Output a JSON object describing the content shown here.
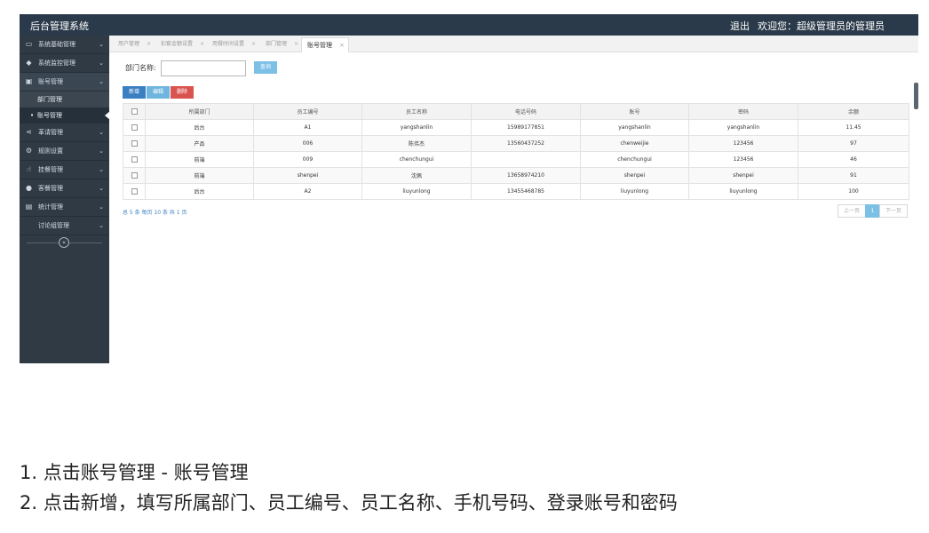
{
  "app": {
    "title": "后台管理系统",
    "logout": "退出",
    "welcome": "欢迎您：超级管理员的管理员"
  },
  "sidebar": {
    "items": [
      {
        "label": "系统基础管理",
        "icon": "monitor-icon"
      },
      {
        "label": "系统监控管理",
        "icon": "tag-icon"
      },
      {
        "label": "账号管理",
        "icon": "image-icon"
      },
      {
        "label": "革请管理",
        "icon": "share-icon"
      },
      {
        "label": "规则设置",
        "icon": "gear-icon"
      },
      {
        "label": "挂餐管理",
        "icon": "hand-icon"
      },
      {
        "label": "客餐管理",
        "icon": "users-icon"
      },
      {
        "label": "统计管理",
        "icon": "chart-icon"
      },
      {
        "label": "讨论组管理",
        "icon": ""
      }
    ],
    "sub_items": [
      {
        "label": "部门管理"
      },
      {
        "label": "账号管理"
      }
    ],
    "collapse_icon": "«"
  },
  "tabs": [
    {
      "label": "用户管理"
    },
    {
      "label": "扣套金额设置"
    },
    {
      "label": "用餐时间设置"
    },
    {
      "label": "部门管理"
    },
    {
      "label": "账号管理"
    }
  ],
  "filter": {
    "label": "部门名称:",
    "value": "",
    "query_button": "查询"
  },
  "actions": {
    "add": "新增",
    "edit": "编辑",
    "delete": "删除"
  },
  "table": {
    "columns": [
      "所属部门",
      "员工编号",
      "员工名称",
      "电话号码",
      "账号",
      "密码",
      "余额"
    ],
    "rows": [
      [
        "后台",
        "A1",
        "yangshanlin",
        "15989177851",
        "yangshanlin",
        "yangshanlin",
        "11.45"
      ],
      [
        "产品",
        "006",
        "陈伟杰",
        "13560437252",
        "chenweijie",
        "123456",
        "97"
      ],
      [
        "前端",
        "009",
        "chenchungui",
        "",
        "chenchungui",
        "123456",
        "46"
      ],
      [
        "前端",
        "shenpei",
        "沈佩",
        "13658974210",
        "shenpei",
        "shenpei",
        "91"
      ],
      [
        "后台",
        "A2",
        "liuyunlong",
        "13455468785",
        "liuyunlong",
        "liuyunlong",
        "100"
      ]
    ]
  },
  "pagination": {
    "summary": "总 5 条  每页 10 条  共 1 页",
    "prev": "上一页",
    "current": "1",
    "next": "下一页"
  },
  "instructions": [
    "1. 点击账号管理 - 账号管理",
    "2. 点击新增，填写所属部门、员工编号、员工名称、手机号码、登录账号和密码"
  ],
  "colors": {
    "topbar": "#2b3a4a",
    "sidebar": "#2f3a45",
    "primary": "#3a7fc1",
    "info": "#7cc0e6",
    "danger": "#d9534f"
  }
}
